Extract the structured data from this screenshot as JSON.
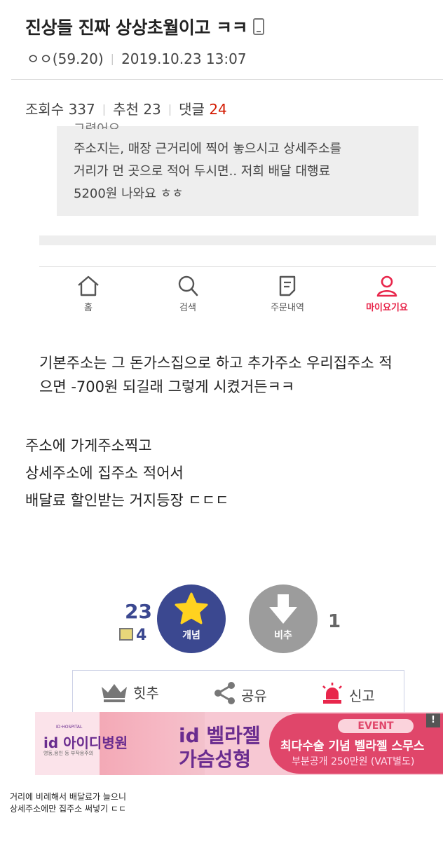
{
  "post": {
    "title": "진상들 진짜 상상초월이고 ㅋㅋ",
    "author": "ㅇㅇ(59.20)",
    "date": "2019.10.23 13:07",
    "views_label": "조회수",
    "views": "337",
    "recommend_label": "추천",
    "recommend": "23",
    "comments_label": "댓글",
    "comments": "24"
  },
  "embedded_screenshot": {
    "cut_line": "그렸어요 ...",
    "quote_lines": [
      "주소지는, 매장 근거리에 찍어 놓으시고 상세주소를",
      "거리가 먼 곳으로 적어 두시면.. 저희 배달 대행료",
      "5200원 나와요 ㅎㅎ"
    ],
    "nav": [
      {
        "label": "홈",
        "icon": "home-icon"
      },
      {
        "label": "검색",
        "icon": "search-icon"
      },
      {
        "label": "주문내역",
        "icon": "order-list-icon"
      },
      {
        "label": "마이요기요",
        "icon": "user-icon",
        "color": "#e8264b"
      }
    ],
    "message_lines": [
      "기본주소는 그 돈가스집으로 하고 추가주소 우리집주소 적",
      "으면 -700원 되길래 그렇게 시켰거든ㅋㅋ"
    ]
  },
  "body_lines": [
    "주소에 가게주소찍고",
    "상세주소에 집주소 적어서",
    "배달료 할인받는 거지등장 ㄷㄷㄷ"
  ],
  "vote": {
    "up_count": "23",
    "fix_count": "4",
    "up_label": "개념",
    "down_label": "비추",
    "down_count": "1",
    "up_color": "#3b4890",
    "down_color": "#9c9c9c"
  },
  "actions": {
    "hit": "힛추",
    "share": "공유",
    "report": "신고"
  },
  "ad": {
    "logo": "id 아이디병원",
    "logo_small": "ID·HOSPITAL",
    "logo_sub": "영동,용인 등 부작용주의",
    "headline1": "id 벨라젤",
    "headline2": "가슴성형",
    "event": "EVENT",
    "offer1": "최다수술 기념 벨라젤 스무스",
    "offer2": "부분공개 250만원 (VAT별도)",
    "badge": "!"
  },
  "caption_lines": [
    "거리에 비례해서 배달료가 늘으니",
    "상세주소에만 집주소 써넣기 ㄷㄷ"
  ]
}
